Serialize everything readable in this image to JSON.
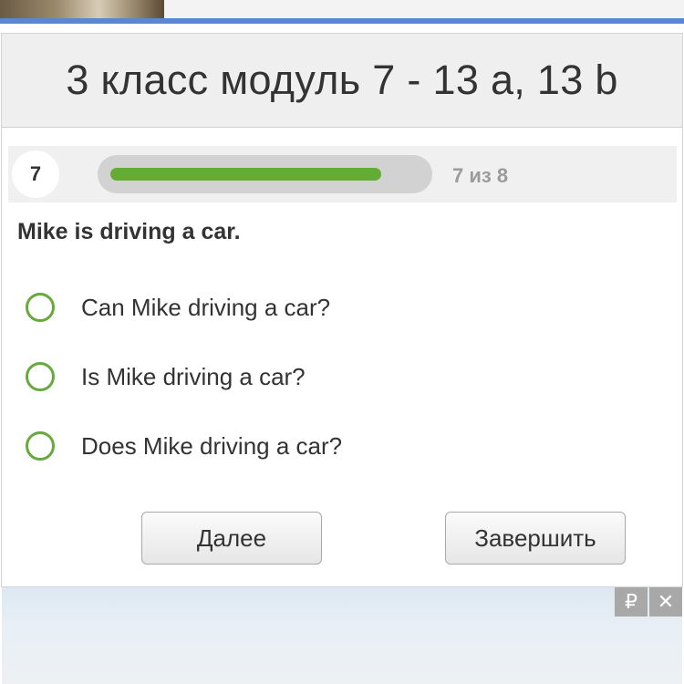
{
  "quiz": {
    "title": "3 класс модуль 7 - 13 a, 13 b",
    "progress": {
      "question_number": "7",
      "count_text": "7 из 8",
      "fraction": 0.875,
      "fill_color": "#63ad34"
    },
    "question": "Mike is driving a car.",
    "options": [
      {
        "label": "Can Mike driving a car?"
      },
      {
        "label": "Is Mike driving a car?"
      },
      {
        "label": "Does Mike driving a car?"
      }
    ],
    "buttons": {
      "next_label": "Далее",
      "finish_label": "Завершить"
    }
  },
  "ad": {
    "ruble_icon": "₽",
    "close_icon": "✕"
  },
  "colors": {
    "accent_green": "#68a93d",
    "top_bar_blue": "#5b86d6"
  }
}
